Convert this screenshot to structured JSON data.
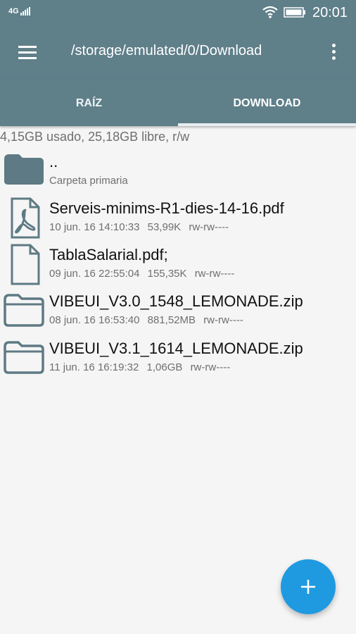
{
  "status_bar": {
    "network": "4G",
    "time": "20:01",
    "icons": [
      "signal-icon",
      "wifi-icon",
      "battery-icon"
    ]
  },
  "app_bar": {
    "path": "/storage/emulated/0/Download",
    "menu_icon": "menu-icon",
    "overflow_icon": "more-vertical-icon"
  },
  "tabs": [
    {
      "label": "RAÍZ",
      "selected": false
    },
    {
      "label": "DOWNLOAD",
      "selected": true
    }
  ],
  "storage_info": "4,15GB usado, 25,18GB libre, r/w",
  "files": [
    {
      "name": "..",
      "subtitle": "Carpeta primaria",
      "icon": "folder-filled-icon"
    },
    {
      "name": "Serveis-minims-R1-dies-14-16.pdf",
      "date": "10 jun. 16 14:10:33",
      "size": "53,99K",
      "perms": "rw-rw----",
      "icon": "pdf-file-icon"
    },
    {
      "name": "TablaSalarial.pdf;",
      "date": "09 jun. 16 22:55:04",
      "size": "155,35K",
      "perms": "rw-rw----",
      "icon": "document-file-icon"
    },
    {
      "name": "VIBEUI_V3.0_1548_LEMONADE.zip",
      "date": "08 jun. 16 16:53:40",
      "size": "881,52MB",
      "perms": "rw-rw----",
      "icon": "folder-outline-icon"
    },
    {
      "name": "VIBEUI_V3.1_1614_LEMONADE.zip",
      "date": "11 jun. 16 16:19:32",
      "size": "1,06GB",
      "perms": "rw-rw----",
      "icon": "folder-outline-icon"
    }
  ],
  "fab": {
    "icon": "plus-icon"
  },
  "colors": {
    "toolbar": "#5f7f89",
    "accent": "#1f9ae0",
    "icon_gray": "#5e7a84"
  }
}
